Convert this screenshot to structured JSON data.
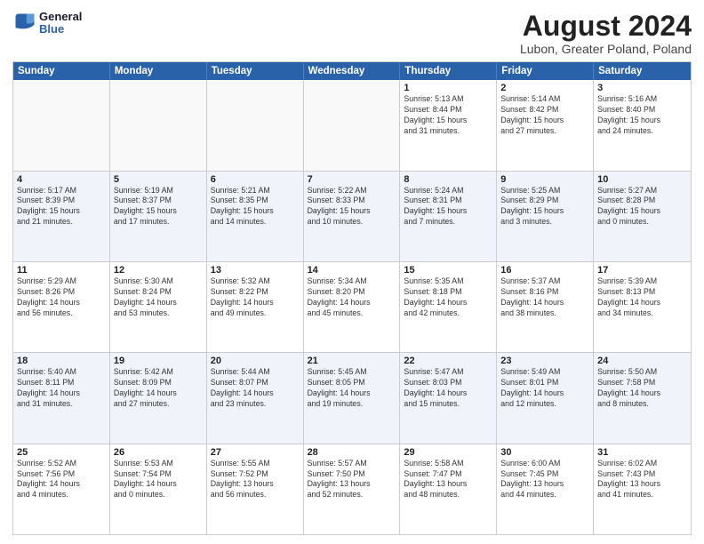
{
  "logo": {
    "line1": "General",
    "line2": "Blue"
  },
  "title": "August 2024",
  "subtitle": "Lubon, Greater Poland, Poland",
  "days_of_week": [
    "Sunday",
    "Monday",
    "Tuesday",
    "Wednesday",
    "Thursday",
    "Friday",
    "Saturday"
  ],
  "rows": [
    [
      {
        "day": "",
        "info": ""
      },
      {
        "day": "",
        "info": ""
      },
      {
        "day": "",
        "info": ""
      },
      {
        "day": "",
        "info": ""
      },
      {
        "day": "1",
        "info": "Sunrise: 5:13 AM\nSunset: 8:44 PM\nDaylight: 15 hours\nand 31 minutes."
      },
      {
        "day": "2",
        "info": "Sunrise: 5:14 AM\nSunset: 8:42 PM\nDaylight: 15 hours\nand 27 minutes."
      },
      {
        "day": "3",
        "info": "Sunrise: 5:16 AM\nSunset: 8:40 PM\nDaylight: 15 hours\nand 24 minutes."
      }
    ],
    [
      {
        "day": "4",
        "info": "Sunrise: 5:17 AM\nSunset: 8:39 PM\nDaylight: 15 hours\nand 21 minutes."
      },
      {
        "day": "5",
        "info": "Sunrise: 5:19 AM\nSunset: 8:37 PM\nDaylight: 15 hours\nand 17 minutes."
      },
      {
        "day": "6",
        "info": "Sunrise: 5:21 AM\nSunset: 8:35 PM\nDaylight: 15 hours\nand 14 minutes."
      },
      {
        "day": "7",
        "info": "Sunrise: 5:22 AM\nSunset: 8:33 PM\nDaylight: 15 hours\nand 10 minutes."
      },
      {
        "day": "8",
        "info": "Sunrise: 5:24 AM\nSunset: 8:31 PM\nDaylight: 15 hours\nand 7 minutes."
      },
      {
        "day": "9",
        "info": "Sunrise: 5:25 AM\nSunset: 8:29 PM\nDaylight: 15 hours\nand 3 minutes."
      },
      {
        "day": "10",
        "info": "Sunrise: 5:27 AM\nSunset: 8:28 PM\nDaylight: 15 hours\nand 0 minutes."
      }
    ],
    [
      {
        "day": "11",
        "info": "Sunrise: 5:29 AM\nSunset: 8:26 PM\nDaylight: 14 hours\nand 56 minutes."
      },
      {
        "day": "12",
        "info": "Sunrise: 5:30 AM\nSunset: 8:24 PM\nDaylight: 14 hours\nand 53 minutes."
      },
      {
        "day": "13",
        "info": "Sunrise: 5:32 AM\nSunset: 8:22 PM\nDaylight: 14 hours\nand 49 minutes."
      },
      {
        "day": "14",
        "info": "Sunrise: 5:34 AM\nSunset: 8:20 PM\nDaylight: 14 hours\nand 45 minutes."
      },
      {
        "day": "15",
        "info": "Sunrise: 5:35 AM\nSunset: 8:18 PM\nDaylight: 14 hours\nand 42 minutes."
      },
      {
        "day": "16",
        "info": "Sunrise: 5:37 AM\nSunset: 8:16 PM\nDaylight: 14 hours\nand 38 minutes."
      },
      {
        "day": "17",
        "info": "Sunrise: 5:39 AM\nSunset: 8:13 PM\nDaylight: 14 hours\nand 34 minutes."
      }
    ],
    [
      {
        "day": "18",
        "info": "Sunrise: 5:40 AM\nSunset: 8:11 PM\nDaylight: 14 hours\nand 31 minutes."
      },
      {
        "day": "19",
        "info": "Sunrise: 5:42 AM\nSunset: 8:09 PM\nDaylight: 14 hours\nand 27 minutes."
      },
      {
        "day": "20",
        "info": "Sunrise: 5:44 AM\nSunset: 8:07 PM\nDaylight: 14 hours\nand 23 minutes."
      },
      {
        "day": "21",
        "info": "Sunrise: 5:45 AM\nSunset: 8:05 PM\nDaylight: 14 hours\nand 19 minutes."
      },
      {
        "day": "22",
        "info": "Sunrise: 5:47 AM\nSunset: 8:03 PM\nDaylight: 14 hours\nand 15 minutes."
      },
      {
        "day": "23",
        "info": "Sunrise: 5:49 AM\nSunset: 8:01 PM\nDaylight: 14 hours\nand 12 minutes."
      },
      {
        "day": "24",
        "info": "Sunrise: 5:50 AM\nSunset: 7:58 PM\nDaylight: 14 hours\nand 8 minutes."
      }
    ],
    [
      {
        "day": "25",
        "info": "Sunrise: 5:52 AM\nSunset: 7:56 PM\nDaylight: 14 hours\nand 4 minutes."
      },
      {
        "day": "26",
        "info": "Sunrise: 5:53 AM\nSunset: 7:54 PM\nDaylight: 14 hours\nand 0 minutes."
      },
      {
        "day": "27",
        "info": "Sunrise: 5:55 AM\nSunset: 7:52 PM\nDaylight: 13 hours\nand 56 minutes."
      },
      {
        "day": "28",
        "info": "Sunrise: 5:57 AM\nSunset: 7:50 PM\nDaylight: 13 hours\nand 52 minutes."
      },
      {
        "day": "29",
        "info": "Sunrise: 5:58 AM\nSunset: 7:47 PM\nDaylight: 13 hours\nand 48 minutes."
      },
      {
        "day": "30",
        "info": "Sunrise: 6:00 AM\nSunset: 7:45 PM\nDaylight: 13 hours\nand 44 minutes."
      },
      {
        "day": "31",
        "info": "Sunrise: 6:02 AM\nSunset: 7:43 PM\nDaylight: 13 hours\nand 41 minutes."
      }
    ]
  ]
}
